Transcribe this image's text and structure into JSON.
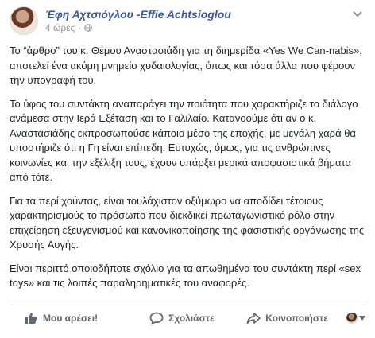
{
  "post": {
    "author": "Έφη Αχτσιόγλου -Effie Achtsioglou",
    "time": "4 ώρες",
    "separator": "·",
    "paragraphs": [
      "Το “άρθρο” του κ. Θέμου Αναστασιάδη για τη διημερίδα «Yes We Can-nabis», αποτελεί ένα ακόμη μνημείο χυδαιολογίας, όπως και τόσα άλλα που φέρουν την υπογραφή του.",
      "Το ύφος του συντάκτη αναπαράγει την ποιότητα που χαρακτήριζε το διάλογο ανάμεσα στην Ιερά Εξέταση και το Γαλιλαίο. Κατανοούμε ότι αν ο κ. Αναστασιάδης εκπροσωπούσε κάποιο μέσο της εποχής, με μεγάλη χαρά θα υποστήριζε ότι η Γη είναι επίπεδη. Ευτυχώς, όμως, για τις ανθρώπινες κοινωνίες και την εξέλιξη τους, έχουν υπάρξει μερικά αποφασιστικά βήματα από τότε.",
      "Για τα περί χούντας, είναι τουλάχιστον οξύμωρο να αποδίδει τέτοιους χαρακτηρισμούς το πρόσωπο που διεκδικεί πρωταγωνιστικό ρόλο στην επιχείρηση εξευγενισμού και κανονικοποίησης της φασιστικής οργάνωσης της Χρυσής Αυγής.",
      "Είναι περιττό οποιοδήποτε σχόλιο για τα απωθημένα του συντάκτη περί «sex toys» και τις λοιπές παραληρηματικές του αναφορές."
    ]
  },
  "actions": {
    "like": "Μου αρέσει!",
    "comment": "Σχολιάστε",
    "share": "Κοινοποιήστε"
  },
  "icons": {
    "globe": "globe-icon",
    "menu": "chevron-down-icon",
    "like": "thumbs-up-icon",
    "comment": "comment-bubble-icon",
    "share": "share-arrow-icon"
  },
  "colors": {
    "author_link": "#365899",
    "meta_gray": "#90949c",
    "action_gray": "#606770"
  }
}
